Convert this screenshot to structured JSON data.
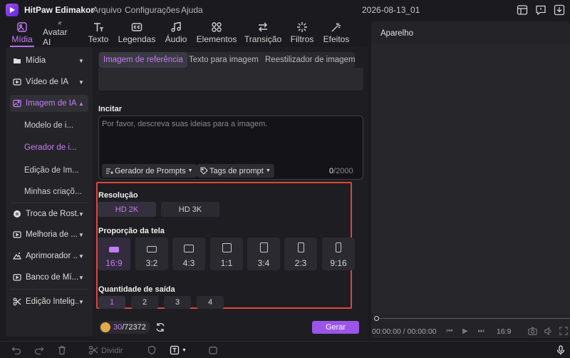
{
  "app": {
    "name": "HitPaw Edimakor",
    "project": "2026-08-13_01"
  },
  "menu": [
    "Arquivo",
    "Configurações",
    "Ajuda"
  ],
  "toolbar": {
    "tabs": [
      "Mídia",
      "Avatar AI",
      "Texto",
      "Legendas",
      "Áudio",
      "Elementos",
      "Transição",
      "Filtros",
      "Efeitos"
    ],
    "active": "Mídia"
  },
  "sidebar": {
    "items": [
      "Mídia",
      "Vídeo de IA",
      "Imagem de IA",
      "Troca de Rost...",
      "Melhoria de ...",
      "Aprimorador ...",
      "Banco de Mí...",
      "Edição Intelig..."
    ],
    "subitems": [
      "Modelo de i...",
      "Gerador de i...",
      "Edição de Im...",
      "Minhas criaçõ..."
    ],
    "selected_item": "Imagem de IA",
    "selected_subitem": "Gerador de i..."
  },
  "tabs": [
    "Imagem de referência",
    "Texto para imagem",
    "Reestilizador de imagem"
  ],
  "prompt": {
    "label": "Incitar",
    "placeholder": "Por favor, descreva suas ideias para a imagem.",
    "generator_btn": "Gerador de Prompts",
    "tags_btn": "Tags de prompt",
    "count": "0",
    "max": "/2000"
  },
  "resolution": {
    "label": "Resolução",
    "options": [
      "HD 2K",
      "HD 3K"
    ],
    "selected": "HD 2K"
  },
  "aspect": {
    "label": "Proporção da tela",
    "options": [
      "16:9",
      "3:2",
      "4:3",
      "1:1",
      "3:4",
      "2:3",
      "9:16"
    ],
    "selected": "16:9"
  },
  "quantity": {
    "label": "Quantidade de saída",
    "options": [
      "1",
      "2",
      "3",
      "4"
    ],
    "selected": "1"
  },
  "credits": {
    "used": "30",
    "total": "/72372"
  },
  "generate_label": "Gerar",
  "preview": {
    "title": "Aparelho",
    "timecode": "00:00:00 / 00:00:00",
    "zoom": "16:9"
  },
  "timeline": {
    "split_label": "Dividir"
  },
  "colors": {
    "accent": "#c57cf5",
    "button": "#9b55e8",
    "highlight_border": "#e0443c"
  }
}
